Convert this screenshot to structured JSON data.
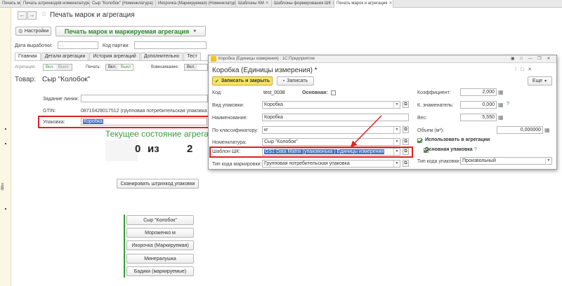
{
  "window_tabs": [
    {
      "label": "Печать марок",
      "active": false
    },
    {
      "label": "Печать штрихкодов номенклатуры",
      "active": false
    },
    {
      "label": "Сыр \"Колобок\" (Номенклатура)",
      "active": false
    },
    {
      "label": "Икорочка (Маркируемая) (Номенклатура)",
      "active": false
    },
    {
      "label": "Шаблоны КМ",
      "active": false
    },
    {
      "label": "Шаблоны формирования ШК",
      "active": false
    },
    {
      "label": "Печать марок и агрегация",
      "active": true
    }
  ],
  "leftstrip": {
    "label": "ходу"
  },
  "form": {
    "title": "Печать марок и агрегация",
    "settings_label": "Настройки",
    "header": "Печать марок и маркируемая агрегация",
    "date_label": "Дата выработки:",
    "date_value": " .  .",
    "batch_label": "Код партии:",
    "tabs": [
      "Главная",
      "Детали агрегации",
      "История агрегаций",
      "Дополнительно",
      "Тест"
    ],
    "aggregation_label": "Агрегация:",
    "agg_on": "Вкл.",
    "agg_off": "Выкл.",
    "print_label": "Печать:",
    "print_on": "Вкл.",
    "print_off": "Выкл",
    "weigh_label": "Взвешивание:",
    "weigh_on": "Вкл.",
    "product_label": "Товар:",
    "product_value": "Сыр \"Колобок\"",
    "line_label": "Задание линии:",
    "gtin_label": "GTIN:",
    "gtin_value": "08710428017512 (групповая потребительская упаковка",
    "package_label": "Упаковка:",
    "package_value": "Коробка",
    "state_title": "Текущее состояние агрегации",
    "count_current": "0",
    "count_of": "из",
    "count_total": "2",
    "scan_button": "Сканировать штрихкод упаковки",
    "products": [
      "Сыр \"Колобок\"",
      "Мороженко м",
      "Икорочка (Маркируемая)",
      "Минералушка",
      "Бадики (маркируемые)"
    ]
  },
  "dialog": {
    "titlebar": "Коробка (Единицы измерения) : 1С:Предприятие",
    "title": "Коробка (Единицы измерения) *",
    "save_close": "Записать и закрыть",
    "save": "Записать",
    "more": "Еще",
    "code_label": "Код:",
    "code_value": "test_0038",
    "main_label": "Основная:",
    "pack_type_label": "Вид упаковки:",
    "pack_type_value": "Коробка",
    "name_label": "Наименование:",
    "name_value": "Коробка",
    "classifier_label": "По классификатору:",
    "classifier_value": "кг",
    "nomenclature_label": "Номенклатура:",
    "nomenclature_value": "Сыр \"Колобок\"",
    "template_label": "Шаблон ШК:",
    "template_value": "GS1 Data Matrix (упаковонька ) Единицы измерения",
    "code_type_label": "Тип кода маркировки:",
    "code_type_value": "Групповая потребительская упаковка",
    "coef_label": "Коэффициент:",
    "coef_value": "2,000",
    "denom_label": "К. знаменатель:",
    "denom_value": "0,000",
    "weight_label": "Вес:",
    "weight_value": "5,550",
    "volume_label": "Объем (м³):",
    "volume_value": "0,000000",
    "use_agg_label": "Использовать в агрегации",
    "main_pack_label": "Основная упаковка",
    "pack_code_type_label": "Тип кода упаковки:",
    "pack_code_type_value": "Произвольный"
  },
  "colors": {
    "accent_green": "#3a9a3a",
    "highlight": "#e02020",
    "selection": "#3f6ec5"
  }
}
